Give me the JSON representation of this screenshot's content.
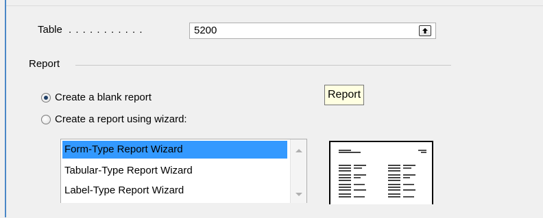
{
  "table": {
    "label": "Table",
    "dots": ". . . . . . . . . . .",
    "value": "5200",
    "lookup_icon": "up-arrow-lookup-icon"
  },
  "report_group": {
    "label": "Report",
    "options": [
      {
        "label": "Create a blank report",
        "checked": true
      },
      {
        "label": "Create a report using wizard:",
        "checked": false
      }
    ],
    "tooltip": "Report"
  },
  "wizard_list": {
    "items": [
      {
        "label": "Form-Type Report Wizard",
        "selected": true
      },
      {
        "label": "Tabular-Type Report Wizard",
        "selected": false
      },
      {
        "label": "Label-Type Report Wizard",
        "selected": false
      }
    ]
  },
  "preview": {
    "icon": "form-layout-preview-icon"
  },
  "colors": {
    "selection": "#3399ff",
    "accent_edge": "#4a87c6",
    "tooltip_bg": "#ffffe1"
  }
}
